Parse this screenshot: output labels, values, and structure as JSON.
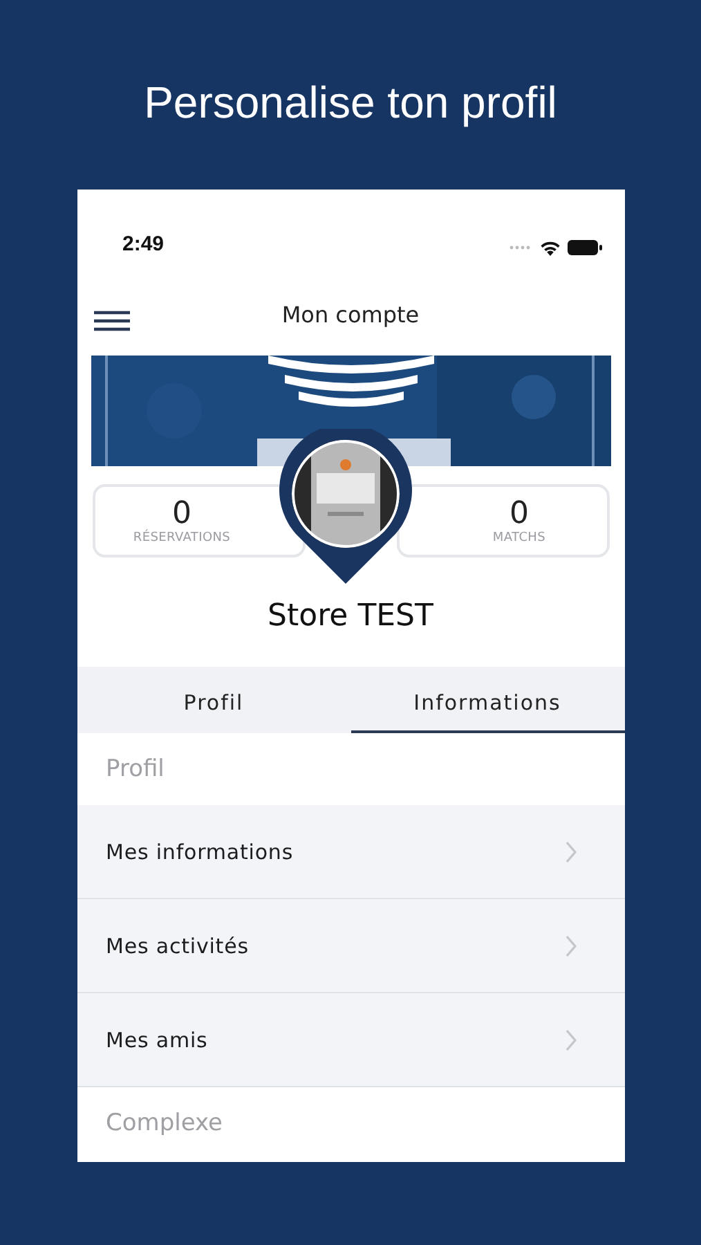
{
  "headline": "Personalise ton profil",
  "status_bar": {
    "time": "2:49"
  },
  "nav": {
    "title": "Mon compte"
  },
  "profile": {
    "name": "Store TEST"
  },
  "stats": [
    {
      "value": "0",
      "label": "RÉSERVATIONS"
    },
    {
      "value": "0",
      "label": "MATCHS"
    }
  ],
  "tabs": [
    {
      "label": "Profil",
      "selected": false
    },
    {
      "label": "Informations",
      "selected": true
    }
  ],
  "sections": [
    {
      "kind": "header",
      "label": "Profil"
    },
    {
      "kind": "link",
      "label": "Mes informations"
    },
    {
      "kind": "link",
      "label": "Mes activités"
    },
    {
      "kind": "link",
      "label": "Mes amis"
    },
    {
      "kind": "header",
      "label": "Complexe"
    }
  ]
}
